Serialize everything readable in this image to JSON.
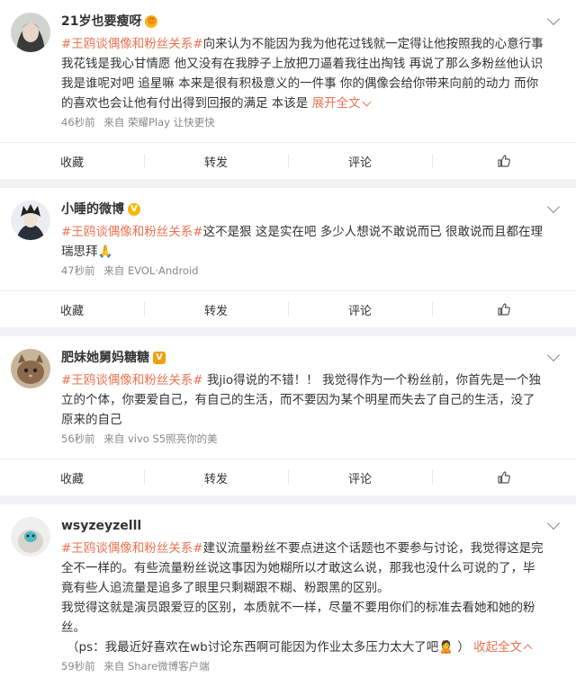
{
  "posts": [
    {
      "username": "21岁也要瘦呀",
      "badge": "😍",
      "topic": "#王鸥谈偶像和粉丝关系#",
      "text": "向来认为不能因为我为他花过钱就一定得让他按照我的心意行事 我花钱是我心甘情愿 他又没有在我脖子上放把刀逼着我往出掏钱 再说了那么多粉丝他认识我是谁呢对吧 追星嘛 本来是很有积极意义的一件事 你的偶像会给你带来向前的动力 而你的喜欢也会让他有付出得到回报的满足 本该是 ",
      "expand_label": "展开全文",
      "time": "46秒前",
      "source": "来自 荣耀Play 让快更快"
    },
    {
      "username": "小睡的微博",
      "badge": "V",
      "topic": "#王鸥谈偶像和粉丝关系#",
      "text": "这不是狠 这是实在吧 多少人想说不敢说而已 很敢说而且都在理 瑞思拜🙏",
      "time": "47秒前",
      "source": "来自 EVOL·Android"
    },
    {
      "username": "肥妹她舅妈糖糖",
      "badge": "V",
      "topic": "#王鸥谈偶像和粉丝关系#",
      "text": " 我jio得说的不错！！ 我觉得作为一个粉丝前，你首先是一个独立的个体，你要爱自己，有自己的生活，而不要因为某个明星而失去了自己的生活，没了原来的自己",
      "time": "56秒前",
      "source": "来自 vivo S5照亮你的美"
    },
    {
      "username": "wsyzeyzelll",
      "topic": "#王鸥谈偶像和粉丝关系#",
      "text": "建议流量粉丝不要点进这个话题也不要参与讨论，我觉得这是完全不一样的。有些流量粉丝说这事因为她糊所以才敢这么说，那我也没什么可说的了，毕竟有些人追流量是追多了眼里只剩糊跟不糊、粉跟黑的区别。",
      "text2": "我觉得这就是演员跟爱豆的区别，本质就不一样，尽量不要用你们的标准去看她和她的粉丝。",
      "text3": "（ps：我最近好喜欢在wb讨论东西啊可能因为作业太多压力太大了吧🙎 ）",
      "collapse_label": "收起全文",
      "time": "59秒前",
      "source": "来自 Share微博客户端"
    }
  ],
  "actions": {
    "collect": "收藏",
    "repost": "转发",
    "comment": "评论"
  },
  "icons": {
    "more": "chevron-down-icon",
    "like": "thumbs-up-icon"
  },
  "colors": {
    "topic": "#eb7350",
    "background": "#f2f2f5"
  }
}
